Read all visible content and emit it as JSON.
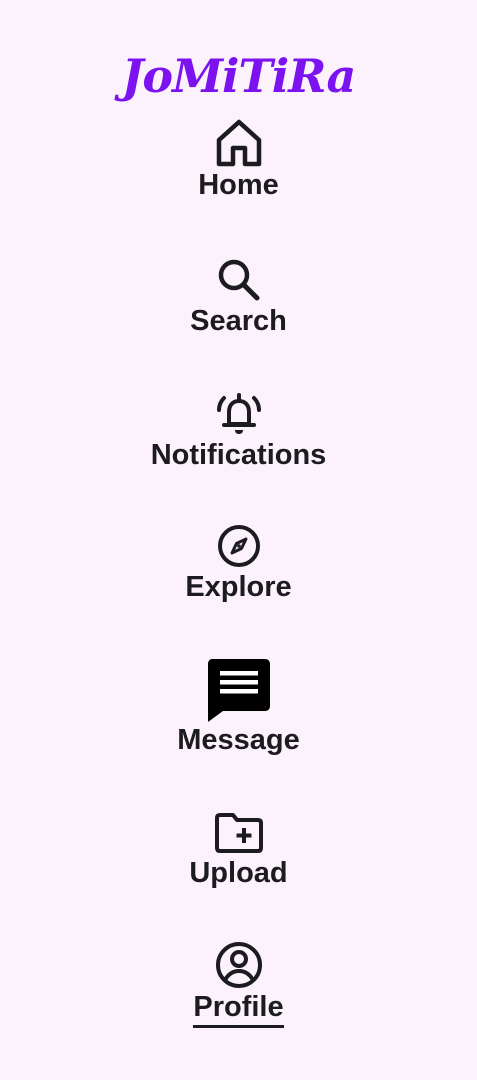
{
  "app": {
    "brand": "JoMiTiRa",
    "brand_color": "#7c12f0",
    "background_color": "#fcf2fc",
    "text_color": "#1c1b1f"
  },
  "nav": {
    "items": [
      {
        "id": "home",
        "label": "Home",
        "icon": "home-icon"
      },
      {
        "id": "search",
        "label": "Search",
        "icon": "search-icon"
      },
      {
        "id": "notifications",
        "label": "Notifications",
        "icon": "bell-ringing-icon"
      },
      {
        "id": "explore",
        "label": "Explore",
        "icon": "compass-icon"
      },
      {
        "id": "message",
        "label": "Message",
        "icon": "chat-message-icon"
      },
      {
        "id": "upload",
        "label": "Upload",
        "icon": "folder-plus-icon"
      },
      {
        "id": "profile",
        "label": "Profile",
        "icon": "account-circle-icon",
        "selected": true
      }
    ]
  }
}
